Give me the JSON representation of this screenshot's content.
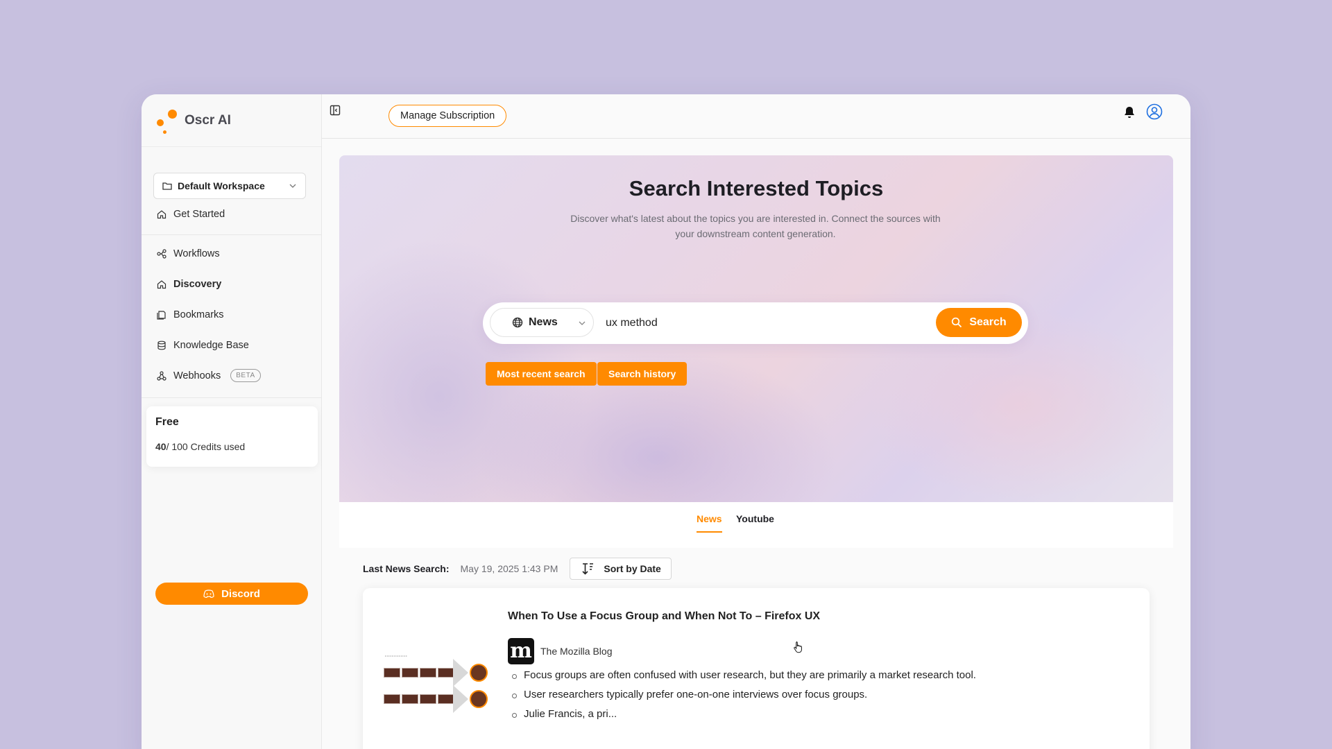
{
  "app": {
    "name": "Oscr AI"
  },
  "sidebar": {
    "workspace": "Default Workspace",
    "get_started": "Get Started",
    "items": [
      {
        "label": "Workflows",
        "icon": "workflow-icon"
      },
      {
        "label": "Discovery",
        "icon": "home-icon",
        "active": true
      },
      {
        "label": "Bookmarks",
        "icon": "bookmark-icon"
      },
      {
        "label": "Knowledge Base",
        "icon": "database-icon"
      },
      {
        "label": "Webhooks",
        "icon": "webhook-icon",
        "badge": "BETA"
      }
    ],
    "plan": {
      "name": "Free",
      "credits_used": "40",
      "credits_total_text": "/ 100 Credits used"
    },
    "discord_label": "Discord"
  },
  "topbar": {
    "manage_subscription": "Manage Subscription"
  },
  "hero": {
    "title": "Search Interested Topics",
    "subtitle": "Discover what's latest about the topics you are interested in. Connect the sources with your downstream content generation."
  },
  "search": {
    "source": "News",
    "query": "ux method",
    "button": "Search",
    "most_recent": "Most recent search",
    "history": "Search history"
  },
  "tabs": [
    {
      "label": "News",
      "active": true
    },
    {
      "label": "Youtube",
      "active": false
    }
  ],
  "results": {
    "last_label": "Last News Search:",
    "last_date": "May 19, 2025 1:43 PM",
    "sort_label": "Sort by Date",
    "items": [
      {
        "title": "When To Use a Focus Group and When Not To – Firefox UX",
        "source": "The Mozilla Blog",
        "source_logo_letter": "m",
        "bullets": [
          "Focus groups are often confused with user research, but they are primarily a market research tool.",
          "User researchers typically prefer one-on-one interviews over focus groups.",
          "Julie Francis, a pri..."
        ]
      }
    ]
  },
  "colors": {
    "accent": "#ff8a00",
    "background": "#c7c0df"
  }
}
